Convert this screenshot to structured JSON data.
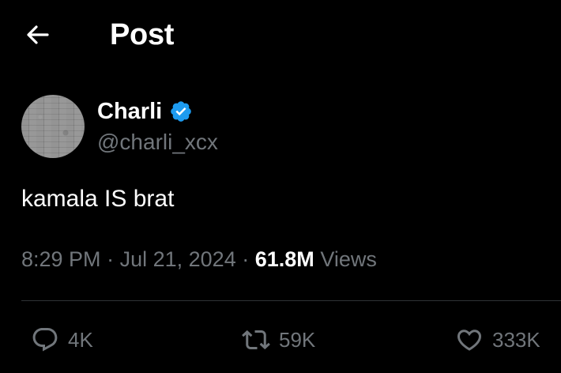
{
  "header": {
    "title": "Post",
    "back_icon": "arrow-left-icon"
  },
  "author": {
    "display_name": "Charli",
    "handle": "@charli_xcx",
    "verified": true,
    "verified_color": "#1d9bf0"
  },
  "post": {
    "text": "kamala IS brat",
    "time": "8:29 PM",
    "date": "Jul 21, 2024",
    "separator": "·",
    "views_count": "61.8M",
    "views_label": "Views"
  },
  "actions": {
    "reply_count": "4K",
    "repost_count": "59K",
    "like_count": "333K"
  },
  "colors": {
    "background": "#000000",
    "primary_text": "#ffffff",
    "secondary_text": "#71767b",
    "divider": "#2f3336"
  }
}
